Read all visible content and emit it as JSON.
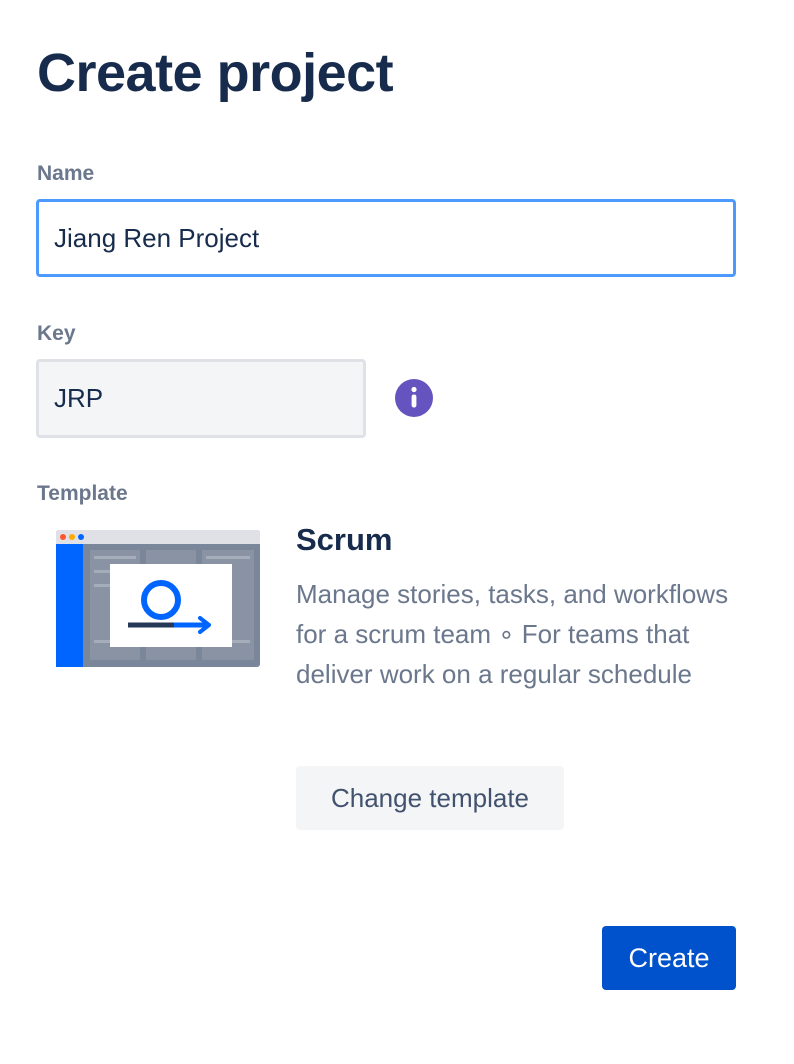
{
  "page": {
    "title": "Create project"
  },
  "form": {
    "name_label": "Name",
    "name_value": "Jiang Ren Project",
    "key_label": "Key",
    "key_value": "JRP",
    "template_label": "Template"
  },
  "template": {
    "name": "Scrum",
    "description": "Manage stories, tasks, and workflows for a scrum team ∘ For teams that deliver work on a regular schedule",
    "change_button_label": "Change template"
  },
  "actions": {
    "create_label": "Create"
  },
  "icons": {
    "info": "info-icon",
    "template": "scrum-loop-icon"
  },
  "colors": {
    "primary": "#0052cc",
    "focus_border": "#4c9aff",
    "info": "#6554c0",
    "heading": "#172b4d",
    "subtle_text": "#6b778c"
  }
}
